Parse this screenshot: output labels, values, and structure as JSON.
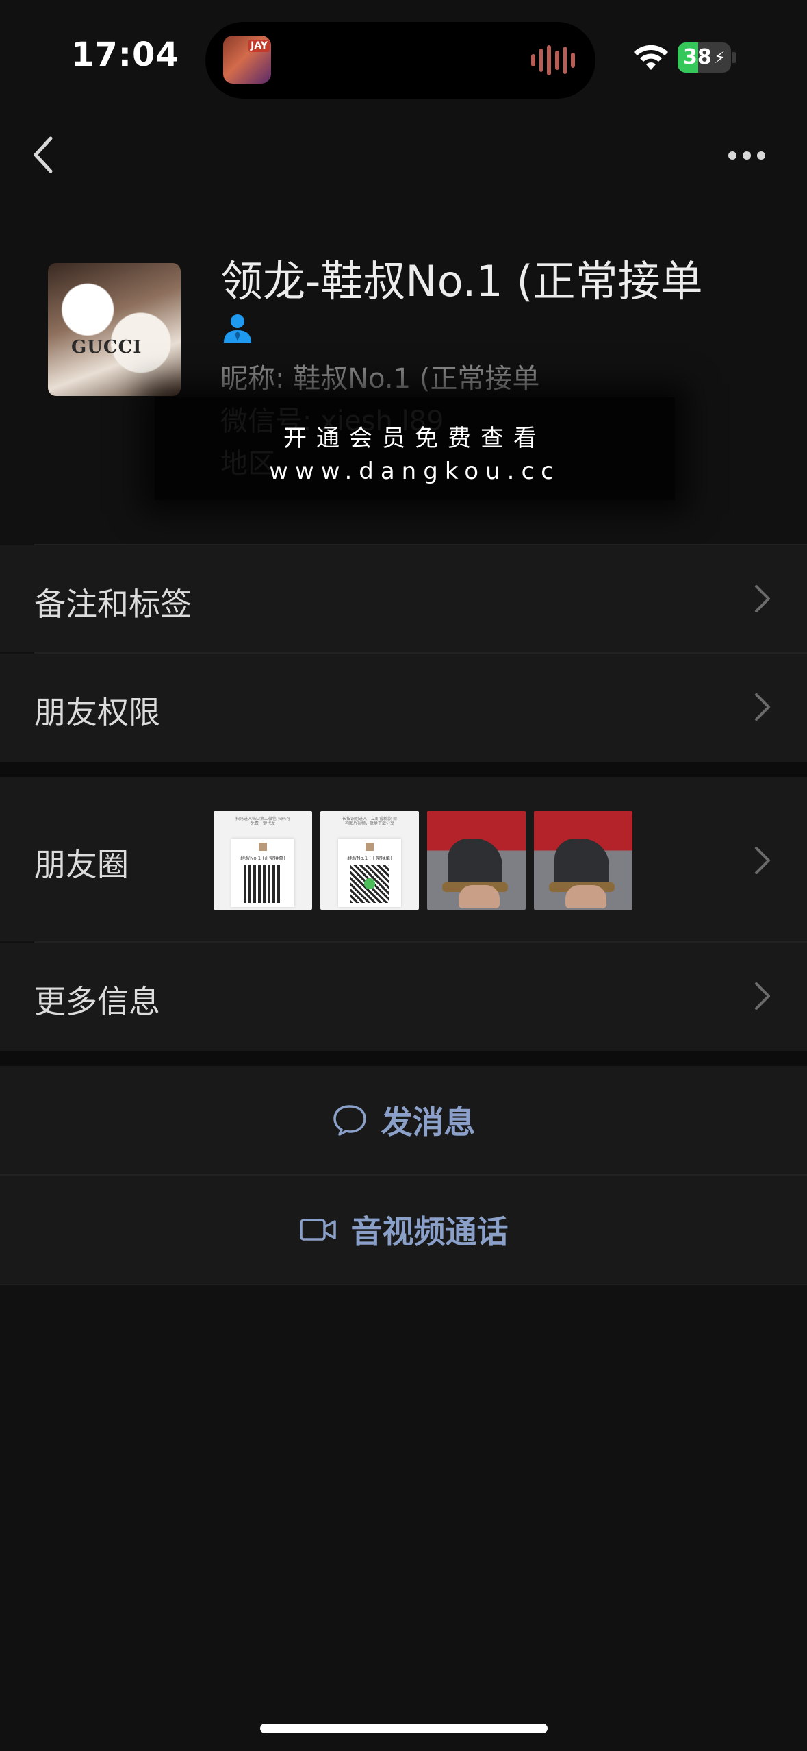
{
  "status_bar": {
    "time": "17:04",
    "island_thumb_label": "JAY",
    "battery_percent": "38",
    "battery_level": 0.38,
    "icons": [
      "wifi-icon",
      "battery-icon",
      "charging-bolt-icon",
      "audio-wave-icon"
    ]
  },
  "nav": {
    "back_icon": "chevron-left-icon",
    "more_icon": "ellipsis-icon"
  },
  "profile": {
    "avatar_text": "GUCCI",
    "name": "领龙-鞋叔No.1 (正常接单",
    "gender_icon": "person-icon",
    "nickname": "昵称: 鞋叔No.1 (正常接单",
    "wechat_id": "微信号: xiesh l89",
    "region": "地区"
  },
  "watermark": {
    "line1": "开通会员免费查看",
    "line2": "www.dangkou.cc"
  },
  "menu": {
    "remarks_tags": "备注和标签",
    "friend_permissions": "朋友权限",
    "moments": "朋友圈",
    "more_info": "更多信息"
  },
  "moments_thumbs": [
    {
      "kind": "qr",
      "top": "扫码进入档口第二微信 扫码可免费一键代发",
      "name": "鞋叔No.1 (正常接单)"
    },
    {
      "kind": "qr",
      "top": "长按识别进入，立即看新款 架构图片视频，批量下载分享",
      "name": "鞋叔No.1 (正常接单)"
    },
    {
      "kind": "boot"
    },
    {
      "kind": "boot"
    }
  ],
  "actions": {
    "send_message": "发消息",
    "voice_video_call": "音视频通话",
    "message_icon": "chat-bubble-icon",
    "video_icon": "video-camera-icon"
  },
  "colors": {
    "background": "#111111",
    "row": "#191919",
    "action_text": "#8aa0c8",
    "battery_green": "#35c759",
    "person_icon": "#1e9bf0"
  }
}
